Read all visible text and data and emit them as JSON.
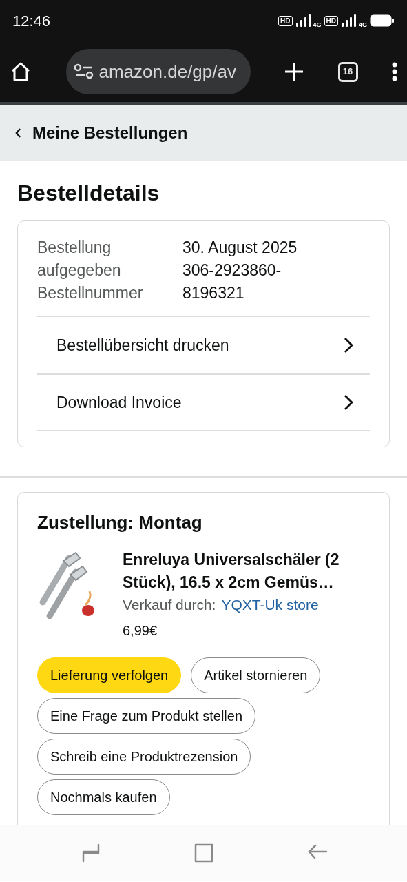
{
  "status_bar": {
    "time": "12:46",
    "sims": [
      {
        "badge": "HD",
        "network": "4G"
      },
      {
        "badge": "HD",
        "network": "4G"
      }
    ]
  },
  "browser": {
    "url": "amazon.de/gp/av",
    "tab_count": "16"
  },
  "breadcrumb": {
    "label": "Meine Bestellungen"
  },
  "page_title": "Bestelldetails",
  "order_info": {
    "rows": [
      {
        "label": "Bestellung aufgegeben",
        "value": "30. August 2025"
      },
      {
        "label": "Bestellnummer",
        "value": "306-2923860-8196321"
      }
    ],
    "links": [
      "Bestellübersicht drucken",
      "Download Invoice"
    ]
  },
  "shipment": {
    "heading": "Zustellung: Montag",
    "item": {
      "kind": "picture",
      "title": "Enreluya Universalschäler (2 Stück), 16.5 x 2cm Gemüs…",
      "seller_label": "Verkauf durch:",
      "seller": "YQXT-Uk store",
      "price": "6,99€"
    },
    "actions": [
      {
        "label": "Lieferung verfolgen",
        "kind": "primary"
      },
      {
        "label": "Artikel stornieren",
        "kind": "secondary"
      },
      {
        "label": "Eine Frage zum Produkt stellen",
        "kind": "secondary"
      },
      {
        "label": "Schreib eine Produktrezension",
        "kind": "secondary"
      },
      {
        "label": "Nochmals kaufen",
        "kind": "secondary"
      }
    ]
  }
}
